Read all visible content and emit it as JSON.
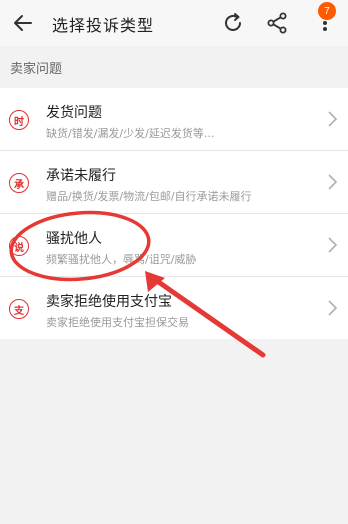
{
  "header": {
    "title": "选择投诉类型",
    "back_icon": "arrow-left-icon",
    "refresh_icon": "refresh-icon",
    "share_icon": "share-icon",
    "more_icon": "more-vertical-icon",
    "badge_count": "7",
    "badge_color": "#ff5a00"
  },
  "section": {
    "label": "卖家问题"
  },
  "items": [
    {
      "icon_char": "时",
      "title": "发货问题",
      "desc": "缺货/错发/漏发/少发/延迟发货等..."
    },
    {
      "icon_char": "承",
      "title": "承诺未履行",
      "desc": "赠品/换货/发票/物流/包邮/自行承诺未履行"
    },
    {
      "icon_char": "说",
      "title": "骚扰他人",
      "desc": "频繁骚扰他人，辱骂/诅咒/威胁"
    },
    {
      "icon_char": "支",
      "title": "卖家拒绝使用支付宝",
      "desc": "卖家拒绝使用支付宝担保交易"
    }
  ],
  "colors": {
    "accent_red": "#e03030",
    "annotation_red": "#e53935"
  }
}
